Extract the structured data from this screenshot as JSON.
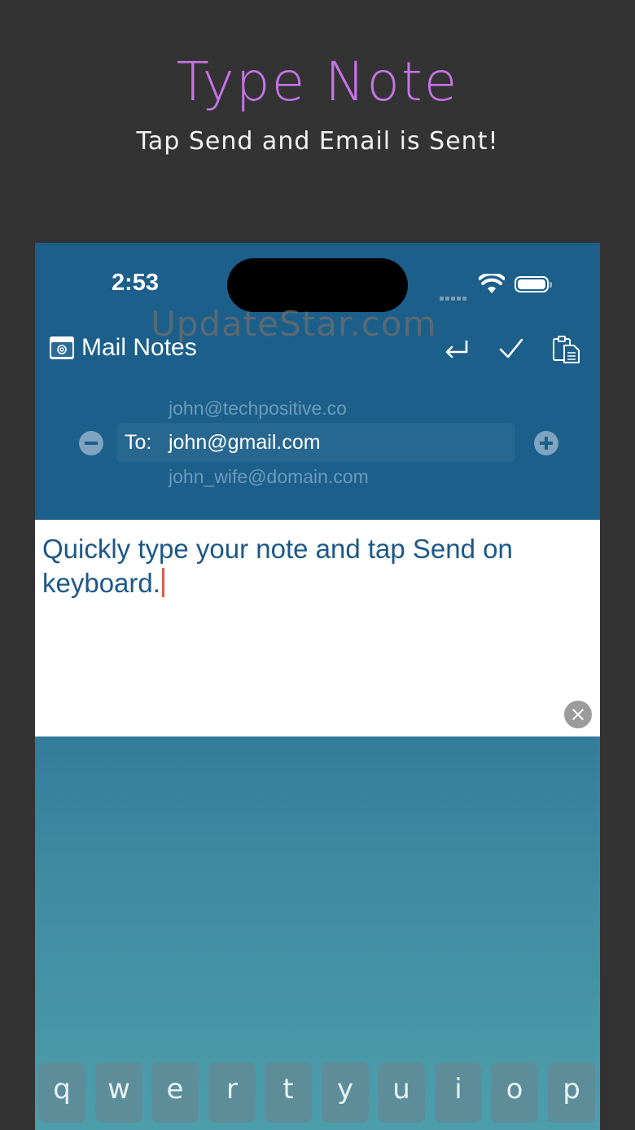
{
  "promo": {
    "title": "Type Note",
    "subtitle": "Tap Send and Email is Sent!"
  },
  "status_bar": {
    "time": "2:53"
  },
  "app": {
    "title": "Mail Notes",
    "logo_icon": "mail-notes-logo-icon",
    "toolbar_icons": [
      "return-icon",
      "checkmark-icon",
      "clipboard-icon"
    ]
  },
  "recipients": {
    "above": "john@techpositive.co",
    "to_label": "To:",
    "selected": "john@gmail.com",
    "below": "john_wife@domain.com"
  },
  "note": {
    "text": "Quickly type your note and tap Send on keyboard."
  },
  "watermark": "UpdateStar.com",
  "keyboard": {
    "row1": [
      "q",
      "w",
      "e",
      "r",
      "t",
      "y",
      "u",
      "i",
      "o",
      "p"
    ]
  },
  "colors": {
    "accent_title": "#c774e8",
    "header_blue": "#1c5f8b",
    "note_text": "#1c5888",
    "caret": "#e05b4c"
  }
}
